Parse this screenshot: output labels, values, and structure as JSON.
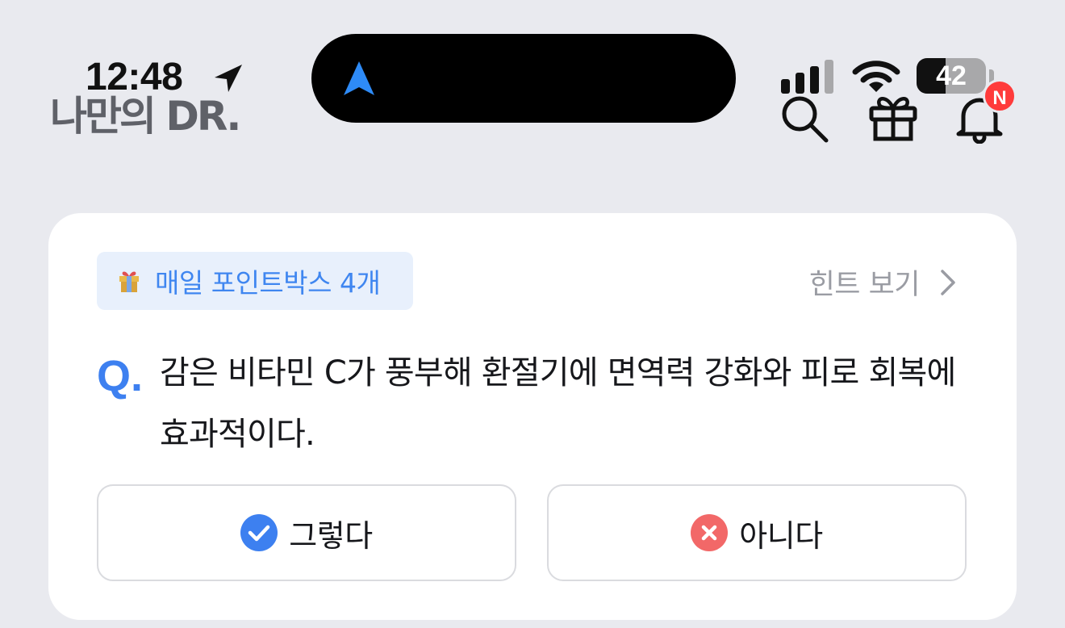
{
  "status_bar": {
    "time": "12:48",
    "battery_level": "42",
    "battery_fraction": 0.42
  },
  "header": {
    "logo_text": "나만의 DR.",
    "notification_badge": "N"
  },
  "quiz": {
    "reward_label": "매일 포인트박스 4개",
    "hint_label": "힌트 보기",
    "question_prefix": "Q.",
    "question_text": "감은 비타민 C가 풍부해 환절기에 면역력 강화와 피로 회복에 효과적이다.",
    "answer_yes_label": "그렇다",
    "answer_no_label": "아니다"
  },
  "colors": {
    "accent_blue": "#3d80f0",
    "badge_red": "#ff3b3b",
    "wrong_red": "#f26868",
    "background": "#e9eaef"
  },
  "icons": {
    "header": [
      "search-icon",
      "gift-icon",
      "bell-icon"
    ],
    "status": [
      "location-arrow-icon",
      "navigation-icon",
      "signal-icon",
      "wifi-icon",
      "battery-icon"
    ],
    "answers": [
      "check-circle-icon",
      "x-circle-icon"
    ]
  }
}
